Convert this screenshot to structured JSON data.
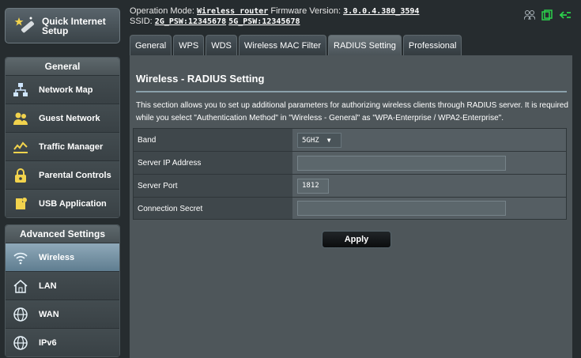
{
  "sidebar": {
    "quick_setup_label": "Quick Internet Setup",
    "general_title": "General",
    "general_items": [
      {
        "label": "Network Map",
        "icon": "network-map-icon"
      },
      {
        "label": "Guest Network",
        "icon": "guest-network-icon"
      },
      {
        "label": "Traffic Manager",
        "icon": "traffic-manager-icon"
      },
      {
        "label": "Parental Controls",
        "icon": "parental-controls-icon"
      },
      {
        "label": "USB Application",
        "icon": "usb-application-icon"
      }
    ],
    "advanced_title": "Advanced Settings",
    "advanced_items": [
      {
        "label": "Wireless",
        "icon": "wireless-icon",
        "active": true
      },
      {
        "label": "LAN",
        "icon": "lan-icon"
      },
      {
        "label": "WAN",
        "icon": "wan-icon"
      },
      {
        "label": "IPv6",
        "icon": "ipv6-icon"
      }
    ]
  },
  "topbar": {
    "operation_mode_label": "Operation Mode:",
    "operation_mode_value": "Wireless router",
    "firmware_label": "Firmware Version:",
    "firmware_value": "3.0.0.4.380_3594",
    "ssid_label": "SSID:",
    "ssid_2g": "2G_PSW:12345678",
    "ssid_5g": "5G_PSW:12345678"
  },
  "tabs": [
    "General",
    "WPS",
    "WDS",
    "Wireless MAC Filter",
    "RADIUS Setting",
    "Professional"
  ],
  "active_tab": "RADIUS Setting",
  "main": {
    "title": "Wireless - RADIUS Setting",
    "description": "This section allows you to set up additional parameters for authorizing wireless clients through RADIUS server. It is required while you select \"Authentication Method\" in \"Wireless - General\" as \"WPA-Enterprise / WPA2-Enterprise\".",
    "rows": {
      "band_label": "Band",
      "band_value": "5GHZ",
      "server_ip_label": "Server IP Address",
      "server_ip_value": "",
      "server_port_label": "Server Port",
      "server_port_value": "1812",
      "secret_label": "Connection Secret",
      "secret_value": ""
    },
    "apply_label": "Apply"
  },
  "colors": {
    "accent_active": "#7f9aab",
    "status_green": "#2bd14b"
  }
}
